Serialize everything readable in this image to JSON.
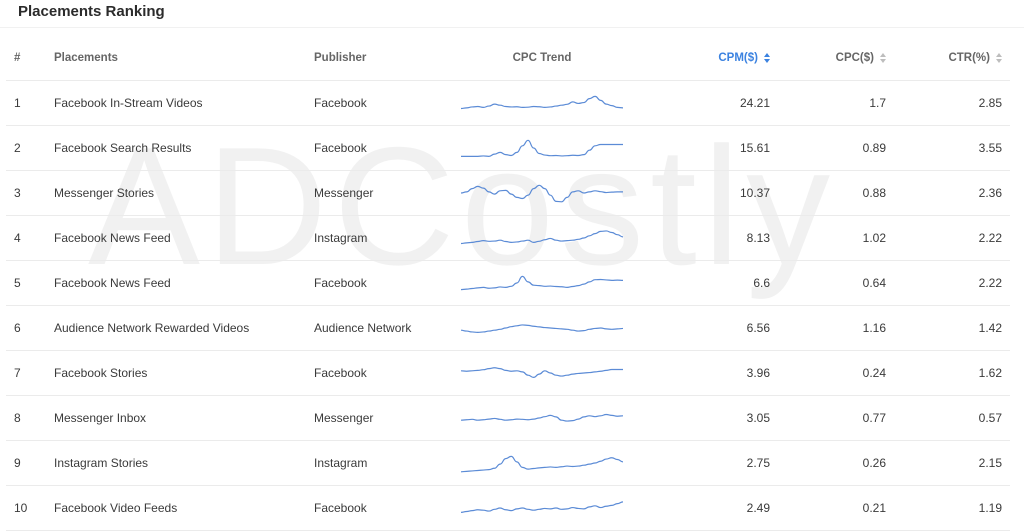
{
  "title": "Placements Ranking",
  "watermark": "ADCostly",
  "colors": {
    "accent": "#3b82e0",
    "spark": "#5b8bd6"
  },
  "columns": {
    "idx": "#",
    "placement": "Placements",
    "publisher": "Publisher",
    "trend": "CPC Trend",
    "cpm": "CPM($)",
    "cpc": "CPC($)",
    "ctr": "CTR(%)"
  },
  "sort": {
    "active": "cpm"
  },
  "rows": [
    {
      "idx": "1",
      "placement": "Facebook In-Stream Videos",
      "publisher": "Facebook",
      "cpm": "24.21",
      "cpc": "1.7",
      "ctr": "2.85",
      "trend": [
        0.25,
        0.28,
        0.32,
        0.34,
        0.3,
        0.36,
        0.45,
        0.4,
        0.34,
        0.32,
        0.33,
        0.3,
        0.31,
        0.34,
        0.33,
        0.3,
        0.32,
        0.36,
        0.4,
        0.44,
        0.55,
        0.48,
        0.52,
        0.7,
        0.8,
        0.62,
        0.45,
        0.38,
        0.3,
        0.28
      ]
    },
    {
      "idx": "2",
      "placement": "Facebook Search Results",
      "publisher": "Facebook",
      "cpm": "15.61",
      "cpc": "0.89",
      "ctr": "3.55",
      "trend": [
        0.12,
        0.12,
        0.12,
        0.12,
        0.14,
        0.12,
        0.22,
        0.3,
        0.2,
        0.16,
        0.3,
        0.6,
        0.85,
        0.5,
        0.25,
        0.18,
        0.15,
        0.16,
        0.14,
        0.15,
        0.17,
        0.16,
        0.2,
        0.4,
        0.6,
        0.66,
        0.66,
        0.66,
        0.66,
        0.66
      ]
    },
    {
      "idx": "3",
      "placement": "Messenger Stories",
      "publisher": "Messenger",
      "cpm": "10.37",
      "cpc": "0.88",
      "ctr": "2.36",
      "trend": [
        0.5,
        0.55,
        0.7,
        0.8,
        0.72,
        0.55,
        0.45,
        0.6,
        0.62,
        0.45,
        0.3,
        0.25,
        0.4,
        0.7,
        0.85,
        0.7,
        0.4,
        0.12,
        0.1,
        0.3,
        0.55,
        0.6,
        0.5,
        0.55,
        0.6,
        0.56,
        0.52,
        0.54,
        0.55,
        0.55
      ]
    },
    {
      "idx": "4",
      "placement": "Facebook News Feed",
      "publisher": "Instagram",
      "cpm": "8.13",
      "cpc": "1.02",
      "ctr": "2.22",
      "trend": [
        0.25,
        0.28,
        0.3,
        0.34,
        0.38,
        0.35,
        0.36,
        0.4,
        0.34,
        0.3,
        0.32,
        0.36,
        0.4,
        0.3,
        0.35,
        0.42,
        0.48,
        0.4,
        0.36,
        0.38,
        0.4,
        0.44,
        0.5,
        0.6,
        0.7,
        0.8,
        0.82,
        0.75,
        0.65,
        0.55
      ]
    },
    {
      "idx": "5",
      "placement": "Facebook News Feed",
      "publisher": "Facebook",
      "cpm": "6.6",
      "cpc": "0.64",
      "ctr": "2.22",
      "trend": [
        0.2,
        0.22,
        0.25,
        0.28,
        0.3,
        0.26,
        0.28,
        0.32,
        0.3,
        0.35,
        0.5,
        0.8,
        0.55,
        0.4,
        0.38,
        0.35,
        0.36,
        0.34,
        0.33,
        0.3,
        0.34,
        0.38,
        0.45,
        0.55,
        0.65,
        0.66,
        0.64,
        0.62,
        0.63,
        0.62
      ]
    },
    {
      "idx": "6",
      "placement": "Audience Network Rewarded Videos",
      "publisher": "Audience Network",
      "cpm": "6.56",
      "cpc": "1.16",
      "ctr": "1.42",
      "trend": [
        0.4,
        0.36,
        0.32,
        0.3,
        0.32,
        0.36,
        0.4,
        0.44,
        0.5,
        0.56,
        0.6,
        0.64,
        0.62,
        0.58,
        0.55,
        0.52,
        0.5,
        0.48,
        0.46,
        0.44,
        0.4,
        0.36,
        0.38,
        0.44,
        0.48,
        0.5,
        0.46,
        0.44,
        0.46,
        0.48
      ]
    },
    {
      "idx": "7",
      "placement": "Facebook Stories",
      "publisher": "Facebook",
      "cpm": "3.96",
      "cpc": "0.24",
      "ctr": "1.62",
      "trend": [
        0.6,
        0.58,
        0.6,
        0.62,
        0.65,
        0.7,
        0.74,
        0.7,
        0.62,
        0.58,
        0.6,
        0.55,
        0.4,
        0.3,
        0.45,
        0.6,
        0.5,
        0.4,
        0.36,
        0.4,
        0.45,
        0.48,
        0.5,
        0.52,
        0.55,
        0.58,
        0.62,
        0.66,
        0.66,
        0.66
      ]
    },
    {
      "idx": "8",
      "placement": "Messenger Inbox",
      "publisher": "Messenger",
      "cpm": "3.05",
      "cpc": "0.77",
      "ctr": "0.57",
      "trend": [
        0.4,
        0.42,
        0.44,
        0.4,
        0.42,
        0.45,
        0.48,
        0.44,
        0.4,
        0.42,
        0.45,
        0.44,
        0.42,
        0.45,
        0.5,
        0.56,
        0.62,
        0.55,
        0.4,
        0.36,
        0.38,
        0.45,
        0.55,
        0.6,
        0.56,
        0.6,
        0.66,
        0.62,
        0.58,
        0.6
      ]
    },
    {
      "idx": "9",
      "placement": "Instagram Stories",
      "publisher": "Instagram",
      "cpm": "2.75",
      "cpc": "0.26",
      "ctr": "2.15",
      "trend": [
        0.1,
        0.12,
        0.14,
        0.16,
        0.18,
        0.2,
        0.26,
        0.45,
        0.7,
        0.8,
        0.55,
        0.3,
        0.22,
        0.25,
        0.28,
        0.3,
        0.32,
        0.3,
        0.33,
        0.36,
        0.34,
        0.36,
        0.4,
        0.45,
        0.5,
        0.58,
        0.68,
        0.74,
        0.66,
        0.55
      ]
    },
    {
      "idx": "10",
      "placement": "Facebook Video Feeds",
      "publisher": "Facebook",
      "cpm": "2.49",
      "cpc": "0.21",
      "ctr": "1.19",
      "trend": [
        0.3,
        0.34,
        0.38,
        0.42,
        0.4,
        0.36,
        0.44,
        0.5,
        0.42,
        0.38,
        0.46,
        0.5,
        0.44,
        0.4,
        0.44,
        0.48,
        0.46,
        0.5,
        0.44,
        0.46,
        0.52,
        0.48,
        0.46,
        0.55,
        0.6,
        0.52,
        0.58,
        0.62,
        0.7,
        0.78
      ]
    }
  ]
}
